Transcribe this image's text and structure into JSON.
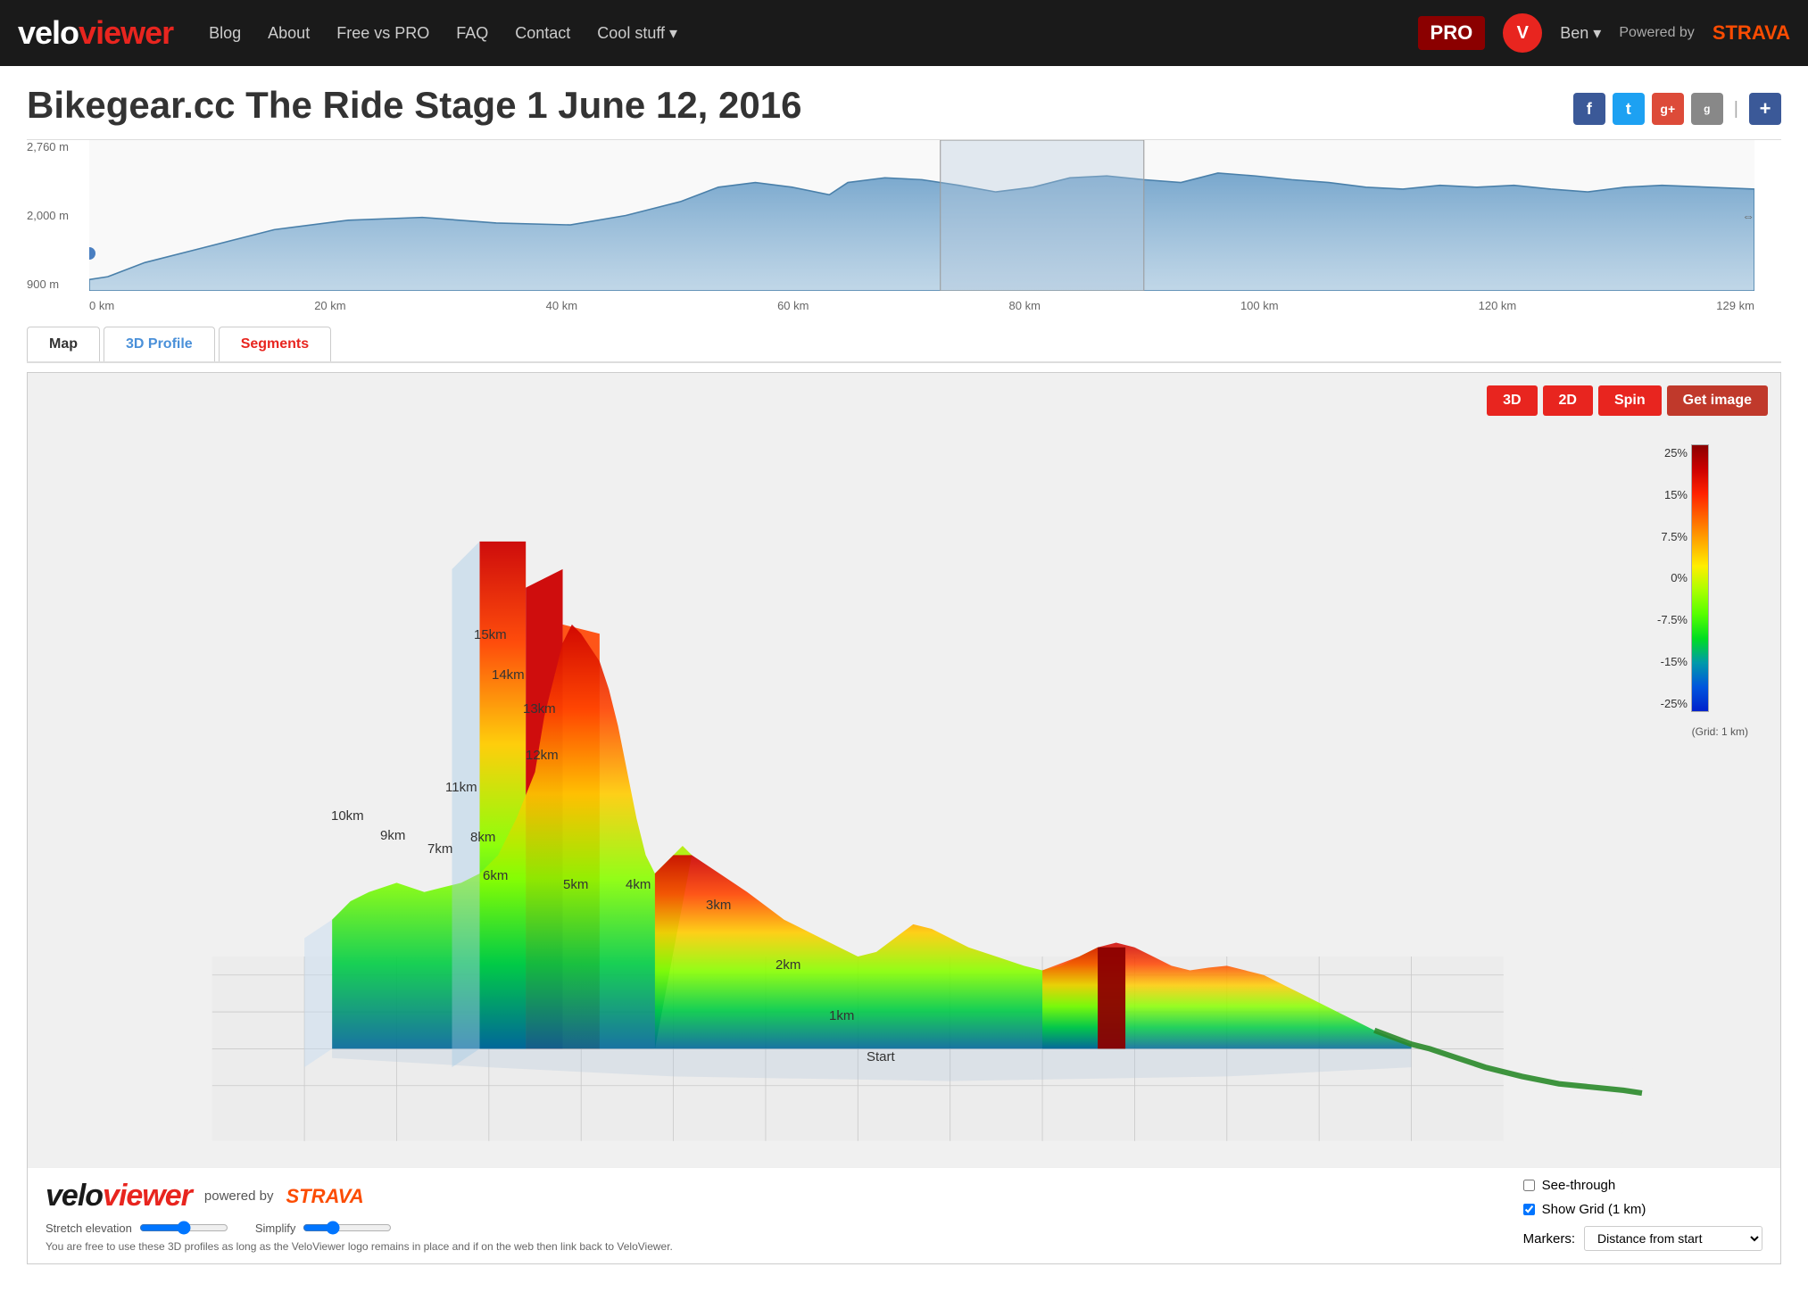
{
  "nav": {
    "logo_velo": "velo",
    "logo_viewer": "viewer",
    "links": [
      {
        "label": "Blog",
        "href": "#"
      },
      {
        "label": "About",
        "href": "#"
      },
      {
        "label": "Free vs PRO",
        "href": "#"
      },
      {
        "label": "FAQ",
        "href": "#"
      },
      {
        "label": "Contact",
        "href": "#"
      },
      {
        "label": "Cool stuff ▾",
        "href": "#"
      }
    ],
    "pro_label": "PRO",
    "user_label": "Ben ▾",
    "powered_label": "Powered by",
    "strava_label": "STRAVA"
  },
  "page": {
    "title": "Bikegear.cc The Ride Stage 1 June 12, 2016"
  },
  "social": {
    "icons": [
      "f",
      "t",
      "g+",
      "g",
      "+"
    ]
  },
  "elevation": {
    "y_labels": [
      "2,760 m",
      "2,000 m",
      "900 m"
    ],
    "x_labels": [
      "0 km",
      "20 km",
      "40 km",
      "60 km",
      "80 km",
      "100 km",
      "120 km",
      "129 km"
    ]
  },
  "tabs": [
    {
      "label": "Map",
      "id": "map",
      "state": "default"
    },
    {
      "label": "3D Profile",
      "id": "3d",
      "state": "active"
    },
    {
      "label": "Segments",
      "id": "segments",
      "state": "red-active"
    }
  ],
  "controls3d": {
    "btn_3d": "3D",
    "btn_2d": "2D",
    "btn_spin": "Spin",
    "btn_getimage": "Get image"
  },
  "km_labels": [
    {
      "text": "15km",
      "left": "500",
      "top": "285"
    },
    {
      "text": "14km",
      "left": "520",
      "top": "330"
    },
    {
      "text": "13km",
      "left": "550",
      "top": "365"
    },
    {
      "text": "12km",
      "left": "558",
      "top": "420"
    },
    {
      "text": "11km",
      "left": "468",
      "top": "455"
    },
    {
      "text": "10km",
      "left": "340",
      "top": "485"
    },
    {
      "text": "9km",
      "left": "395",
      "top": "508"
    },
    {
      "text": "7km",
      "left": "448",
      "top": "525"
    },
    {
      "text": "8km",
      "left": "496",
      "top": "512"
    },
    {
      "text": "6km",
      "left": "510",
      "top": "555"
    },
    {
      "text": "5km",
      "left": "600",
      "top": "565"
    },
    {
      "text": "4km",
      "left": "670",
      "top": "563"
    },
    {
      "text": "3km",
      "left": "760",
      "top": "588"
    },
    {
      "text": "2km",
      "left": "838",
      "top": "655"
    },
    {
      "text": "1km",
      "left": "898",
      "top": "712"
    },
    {
      "text": "Start",
      "left": "940",
      "top": "758"
    }
  ],
  "scale": {
    "labels": [
      "25%",
      "15%",
      "7.5%",
      "0%",
      "-7.5%",
      "-15%",
      "-25%"
    ],
    "grid_note": "(Grid: 1 km)"
  },
  "bottom": {
    "logo_velo": "velo",
    "logo_viewer": "viewer",
    "powered": "powered by",
    "strava": "STRAVA",
    "stretch_label": "Stretch elevation",
    "simplify_label": "Simplify",
    "legal": "You are free to use these 3D profiles as long as the VeloViewer logo remains in place and if on the web then link back to VeloViewer.",
    "see_through_label": "See-through",
    "show_grid_label": "Show Grid (1 km)",
    "markers_label": "Markers:",
    "markers_value": "Distance from start"
  },
  "side_label": "None"
}
